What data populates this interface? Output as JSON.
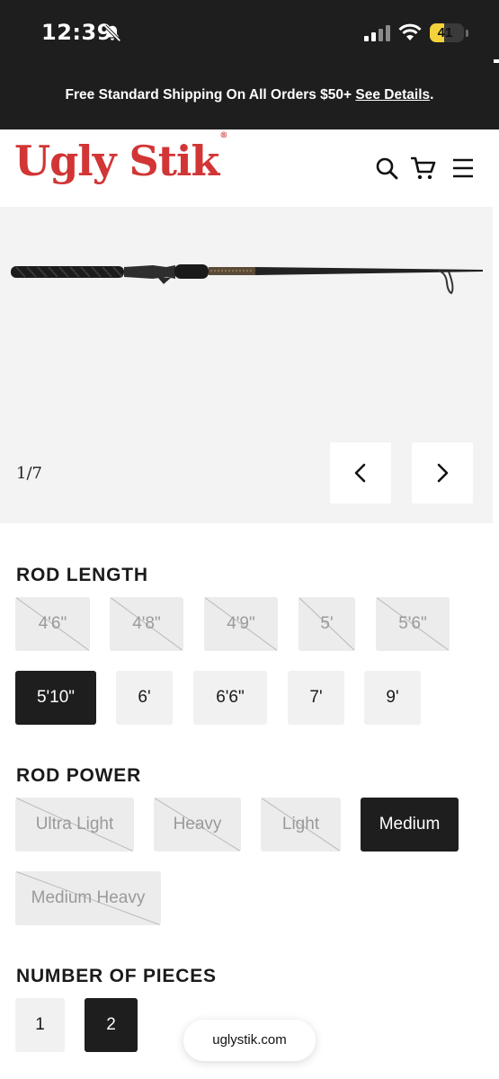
{
  "status_bar": {
    "time": "12:39",
    "battery": "41",
    "battery_level": 0.41
  },
  "announcement": {
    "text": "Free Standard Shipping On All Orders $50+ ",
    "link": "See Details",
    "suffix": "."
  },
  "header": {
    "logo": "Ugly Stik",
    "logo_mark": "®",
    "icons": [
      "search-icon",
      "cart-icon",
      "menu-icon"
    ]
  },
  "gallery": {
    "counter": "1/7",
    "prev_icon": "chevron-left-icon",
    "next_icon": "chevron-right-icon"
  },
  "rod_length": {
    "title": "ROD LENGTH",
    "options": [
      {
        "label": "4'6\"",
        "state": "unavailable"
      },
      {
        "label": "4'8\"",
        "state": "unavailable"
      },
      {
        "label": "4'9\"",
        "state": "unavailable"
      },
      {
        "label": "5'",
        "state": "unavailable"
      },
      {
        "label": "5'6\"",
        "state": "unavailable"
      },
      {
        "label": "5'10\"",
        "state": "selected"
      },
      {
        "label": "6'",
        "state": "available"
      },
      {
        "label": "6'6\"",
        "state": "available"
      },
      {
        "label": "7'",
        "state": "available"
      },
      {
        "label": "9'",
        "state": "available"
      }
    ]
  },
  "rod_power": {
    "title": "ROD POWER",
    "options": [
      {
        "label": "Ultra Light",
        "state": "unavailable"
      },
      {
        "label": "Heavy",
        "state": "unavailable"
      },
      {
        "label": "Light",
        "state": "unavailable"
      },
      {
        "label": "Medium",
        "state": "selected"
      },
      {
        "label": "Medium Heavy",
        "state": "unavailable"
      }
    ]
  },
  "pieces": {
    "title": "NUMBER OF PIECES",
    "options": [
      {
        "label": "1",
        "state": "available"
      },
      {
        "label": "2",
        "state": "selected"
      }
    ]
  },
  "footer": {
    "url": "uglystik.com"
  },
  "colors": {
    "dark": "#1e1e1e",
    "brand_red": "#d23535",
    "battery": "#f3d23b",
    "chip": "#ececec"
  }
}
